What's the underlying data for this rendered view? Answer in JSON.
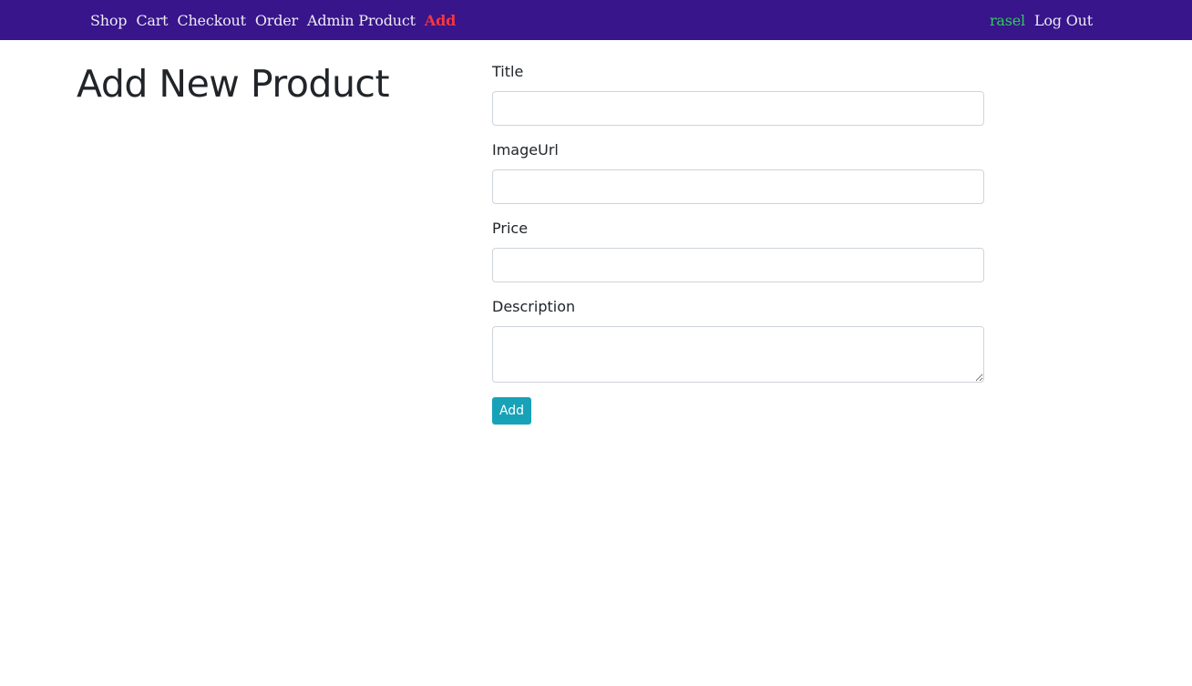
{
  "navbar": {
    "background": "#38158a",
    "links": [
      {
        "label": "Shop"
      },
      {
        "label": "Cart"
      },
      {
        "label": "Checkout"
      },
      {
        "label": "Order"
      },
      {
        "label": "Admin Product"
      },
      {
        "label": "Add",
        "active": true,
        "color": "#f4363f"
      }
    ],
    "user": {
      "name": "rasel",
      "color": "#2ecc5a"
    },
    "logout_label": "Log Out"
  },
  "page": {
    "title": "Add New Product"
  },
  "form": {
    "fields": [
      {
        "label": "Title",
        "value": ""
      },
      {
        "label": "ImageUrl",
        "value": ""
      },
      {
        "label": "Price",
        "value": ""
      },
      {
        "label": "Description",
        "value": ""
      }
    ],
    "submit_label": "Add",
    "submit_color": "#17a2b8"
  }
}
